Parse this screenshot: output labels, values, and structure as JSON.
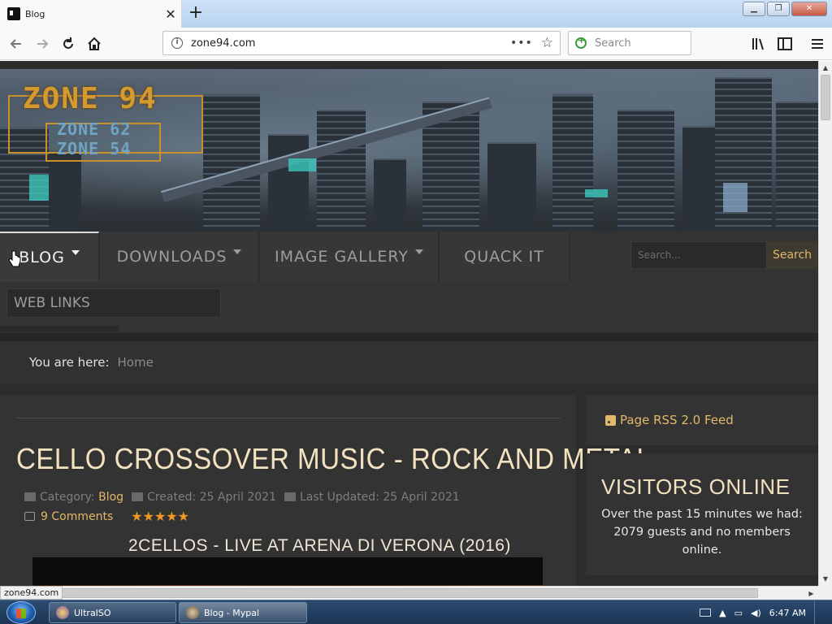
{
  "browser": {
    "tab_title": "Blog",
    "url": "zone94.com",
    "search_placeholder": "Search",
    "status_link": "zone94.com",
    "new_tab": "+",
    "close": "✕",
    "page_actions": "•••",
    "bookmark": "☆"
  },
  "site": {
    "logo_main": "ZONE 94",
    "logo_sub1": "ZONE 62",
    "logo_sub2": "ZONE 54",
    "menu": [
      {
        "label": "BLOG",
        "dropdown": true,
        "active": true
      },
      {
        "label": "DOWNLOADS",
        "dropdown": true,
        "active": false
      },
      {
        "label": "IMAGE GALLERY",
        "dropdown": true,
        "active": false
      },
      {
        "label": "QUACK IT",
        "dropdown": false,
        "active": false
      },
      {
        "label": "WEB LINKS",
        "dropdown": false,
        "active": false
      }
    ],
    "search_placeholder": "Search...",
    "search_button": "Search",
    "accent": "#e2b86a",
    "breadcrumb": {
      "label": "You are here:",
      "home": "Home"
    }
  },
  "article": {
    "title": "CELLO CROSSOVER MUSIC - ROCK AND METAL",
    "category_label": "Category:",
    "category": "Blog",
    "created": "Created: 25 April 2021",
    "updated": "Last Updated: 25 April 2021",
    "comments": "9 Comments",
    "rating_stars": 5,
    "stars": "★★★★★",
    "subtitle": "2CELLOS - LIVE AT ARENA DI VERONA (2016)"
  },
  "sidebar": {
    "rss": "Page RSS 2.0 Feed",
    "visitors_title": "VISITORS ONLINE",
    "visitors_text": "Over the past 15 minutes we had: 2079 guests and no members online."
  },
  "taskbar": {
    "items": [
      {
        "label": "UltraISO",
        "active": false
      },
      {
        "label": "Blog - Mypal",
        "active": true
      }
    ],
    "time": "6:47 AM"
  }
}
